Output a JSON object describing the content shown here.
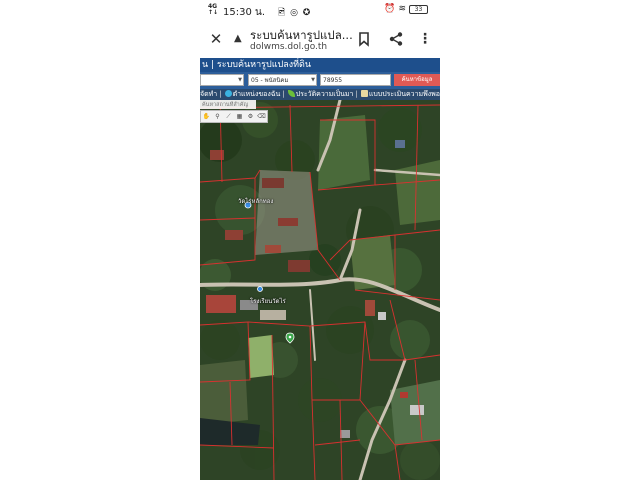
{
  "status_bar": {
    "network": "4G\n↑↓",
    "time": "15:30 น.",
    "notification_icons": "🖻 ◎ ✪",
    "alarm_icon": "⏰",
    "battery_level": "33"
  },
  "browser": {
    "page_title": "ระบบค้นหารูปแปล...",
    "url": "dolwms.dol.go.th"
  },
  "site": {
    "header_title": "น | ระบบค้นหารูปแปลงที่ดิน",
    "province_select": "",
    "district_select": "05 - พนัสนิคม",
    "parcel_number": "78955",
    "search_button": "ค้นหาข้อมูล",
    "menu": {
      "item_1": "จัดทำ",
      "item_2": "ตำแหน่งของฉัน",
      "item_3": "ประวัติความเป็นมา",
      "item_4": "แบบประเมินความพึงพอใจ"
    },
    "map_search_placeholder": "ค้นหาสถานที่สำคัญ"
  },
  "map": {
    "label_temple": "วัดไร่หลักทอง",
    "label_school": "โรงเรียนวัดไร่"
  },
  "colors": {
    "header_bg": "#1e4f8c",
    "search_row_bg": "#2d5e9a",
    "menu_row_bg": "#2b4a6e",
    "search_button_bg": "#e05a55",
    "parcel_line": "#e03030"
  }
}
